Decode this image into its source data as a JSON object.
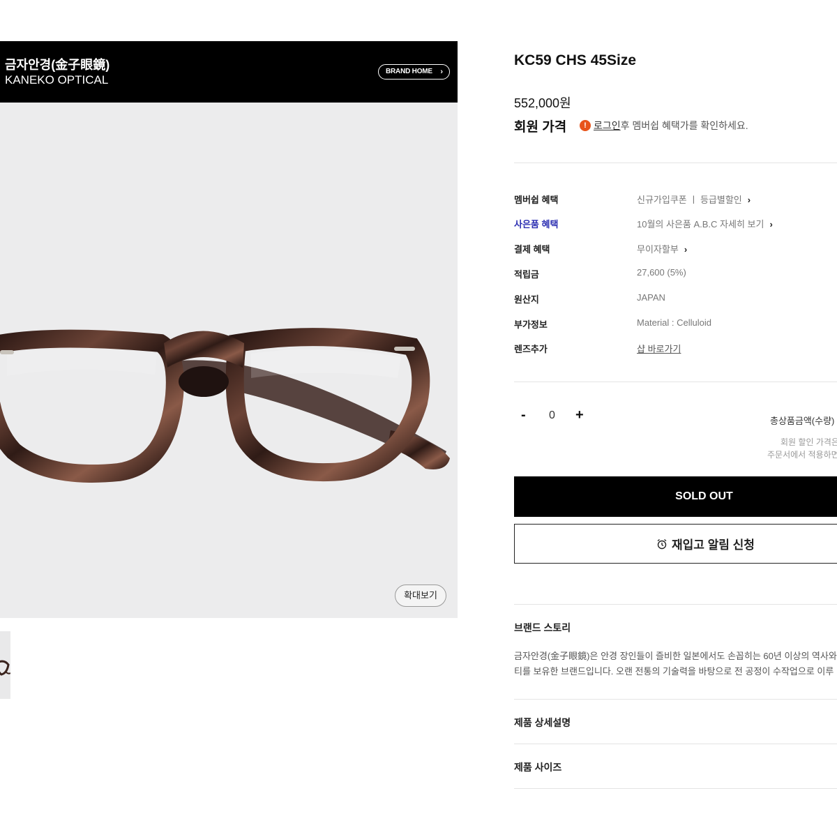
{
  "brand": {
    "name_kr": "금자안경(金子眼鏡)",
    "name_en": "KANEKO OPTICAL",
    "home_label": "BRAND HOME"
  },
  "gallery": {
    "zoom_label": "확대보기",
    "main_image_icon": "eyeglasses-image",
    "frame_color": "#3b2420",
    "background_color": "#ececed"
  },
  "product": {
    "title": "KC59 CHS 45Size",
    "price": "552,000원",
    "member_price_label": "회원 가격",
    "login_notice": {
      "link": "로그인",
      "text": " 후 멤버쉽 혜택가를 확인하세요."
    }
  },
  "info_rows": [
    {
      "label": "멤버쉽 혜택",
      "value": "신규가입쿠폰 ㅣ 등급별할인"
    },
    {
      "label": "사은품 혜택",
      "value": "10월의 사은품 A.B.C 자세히 보기"
    },
    {
      "label": "결제 혜택",
      "value": "무이자할부"
    },
    {
      "label": "적립금",
      "value": "27,600 (5%)"
    },
    {
      "label": "원산지",
      "value": "JAPAN"
    },
    {
      "label": "부가정보",
      "value": "Material : Celluloid"
    },
    {
      "label": "렌즈추가",
      "value": "샵 바로가기"
    }
  ],
  "quantity": {
    "minus": "-",
    "value": "0",
    "plus": "+",
    "total_label": "총상품금액(수량)",
    "note_line1": "회원 할인 가격은",
    "note_line2": "주문서에서 적용하면"
  },
  "actions": {
    "soldout_label": "SOLD OUT",
    "restock_label": "재입고 알림 신청"
  },
  "sections": {
    "brand_story_title": "브랜드 스토리",
    "brand_story_line1": "금자안경(金子眼鏡)은 안경 장인들이 즐비한 일본에서도 손꼽히는 60년 이상의 역사와",
    "brand_story_line2": "티를 보유한 브랜드입니다. 오랜 전통의 기술력을 바탕으로 전 공정이 수작업으로 이루",
    "detail_title": "제품 상세설명",
    "size_title": "제품 사이즈"
  },
  "colors": {
    "accent_label": "#2c2fb2",
    "info_icon": "#e8541b",
    "soldout_bg": "#000000"
  }
}
